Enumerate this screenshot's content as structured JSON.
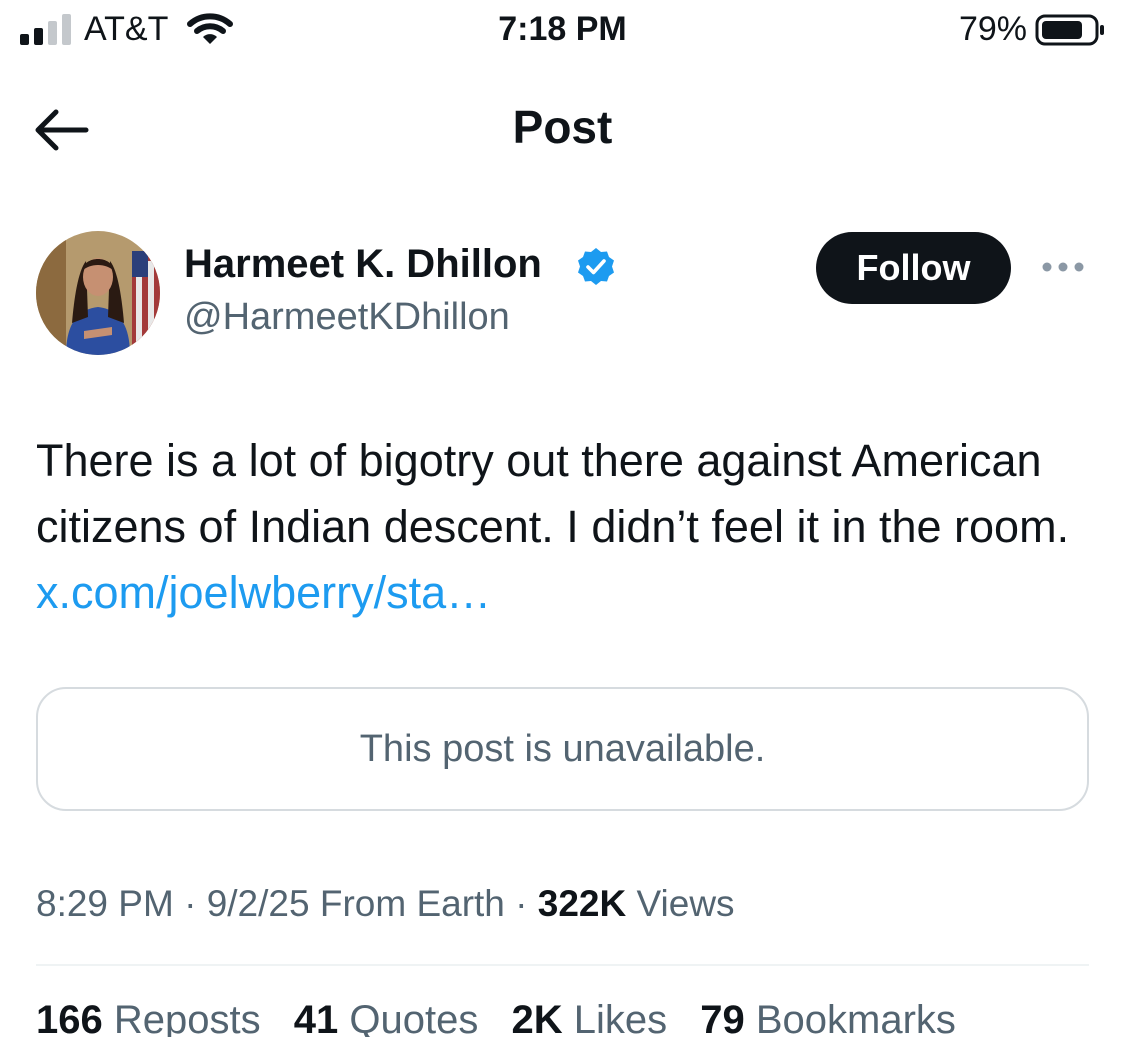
{
  "status_bar": {
    "carrier": "AT&T",
    "time": "7:18 PM",
    "battery": "79%",
    "battery_level": 0.79
  },
  "header": {
    "title": "Post"
  },
  "author": {
    "name": "Harmeet K. Dhillon",
    "handle": "@HarmeetKDhillon",
    "verified": true,
    "follow_label": "Follow"
  },
  "post": {
    "text": "There is a lot of bigotry out there against American citizens of Indian descent. I didn’t feel it in the room. ",
    "link": "x.com/joelwberry/sta…",
    "quote_unavailable": "This post is unavailable."
  },
  "meta": {
    "time": "8:29 PM",
    "date": "9/2/25",
    "location": "From Earth",
    "views_count": "322K",
    "views_label": "Views"
  },
  "stats": [
    {
      "count": "166",
      "label": "Reposts"
    },
    {
      "count": "41",
      "label": "Quotes"
    },
    {
      "count": "2K",
      "label": "Likes"
    },
    {
      "count": "79",
      "label": "Bookmarks"
    }
  ],
  "colors": {
    "accent": "#1d9bf0",
    "text": "#0f1419",
    "muted": "#536471",
    "border": "#d6dbdf"
  }
}
